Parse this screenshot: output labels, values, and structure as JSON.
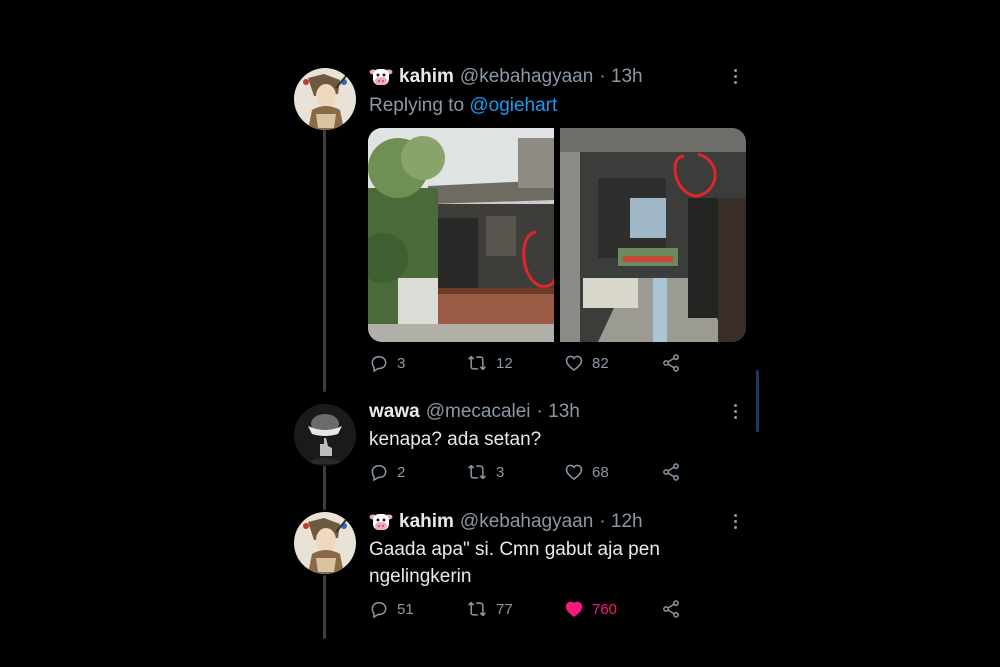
{
  "tweets": [
    {
      "name": "kahim",
      "handle": "@kebahagyaan",
      "time": "· 13h",
      "reply_prefix": "Replying to ",
      "reply_mention": "@ogiehart",
      "stats": {
        "replies": "3",
        "retweets": "12",
        "likes": "82"
      }
    },
    {
      "name": "wawa",
      "handle": "@mecacalei",
      "time": "· 13h",
      "text": "kenapa? ada setan?",
      "stats": {
        "replies": "2",
        "retweets": "3",
        "likes": "68"
      }
    },
    {
      "name": "kahim",
      "handle": "@kebahagyaan",
      "time": "· 12h",
      "text_line1": "Gaada apa\" si. Cmn gabut aja pen",
      "text_line2": "ngelingkerin",
      "stats": {
        "replies": "51",
        "retweets": "77",
        "likes": "760"
      },
      "liked": true
    }
  ],
  "icons": {
    "reply": "reply-icon",
    "retweet": "retweet-icon",
    "like": "heart-icon",
    "share": "share-icon",
    "more": "more-icon",
    "badge": "cow-emoji-icon"
  },
  "colors": {
    "background": "#000000",
    "text": "#e7e9ea",
    "muted": "#8b98a5",
    "mention": "#1d9bf0",
    "like_active": "#f91880",
    "circle_annotation": "#e0262b"
  }
}
